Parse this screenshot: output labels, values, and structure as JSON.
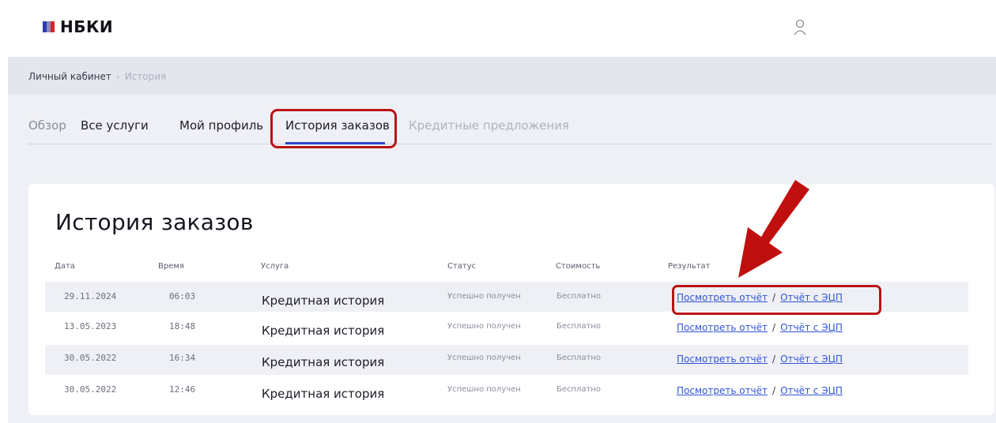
{
  "app": {
    "logo_text": "НБКИ"
  },
  "colors": {
    "accent_blue": "#2f45c8",
    "link_blue": "#2f54d8",
    "annotation_red": "#b81414",
    "logo_red": "#d1262e",
    "logo_blue": "#2b3fb2"
  },
  "icons": {
    "user": "user-icon",
    "arrow": "arrow-annotation-icon"
  },
  "breadcrumb": {
    "home": "Личный кабинет",
    "separator": "›",
    "current": "История"
  },
  "tabs": [
    {
      "label": "Обзор"
    },
    {
      "label": "Все услуги"
    },
    {
      "label": "Мой профиль"
    },
    {
      "label": "История заказов",
      "active": true
    },
    {
      "label": "Кредитные предложения"
    }
  ],
  "orders": {
    "title": "История заказов",
    "columns": [
      "Дата",
      "Время",
      "Услуга",
      "Статус",
      "Стоимость",
      "Результат"
    ],
    "rows": [
      {
        "date": "29.11.2024",
        "time": "06:03",
        "service": "Кредитная история",
        "status": "Успешно получен",
        "cost": "Бесплатно",
        "link_report": "Посмотреть отчёт",
        "link_ecp": "Отчёт с ЭЦП"
      },
      {
        "date": "13.05.2023",
        "time": "18:48",
        "service": "Кредитная история",
        "status": "Успешно получен",
        "cost": "Бесплатно",
        "link_report": "Посмотреть отчёт",
        "link_ecp": "Отчёт с ЭЦП"
      },
      {
        "date": "30.05.2022",
        "time": "16:34",
        "service": "Кредитная история",
        "status": "Успешно получен",
        "cost": "Бесплатно",
        "link_report": "Посмотреть отчёт",
        "link_ecp": "Отчёт с ЭЦП"
      },
      {
        "date": "30.05.2022",
        "time": "12:46",
        "service": "Кредитная история",
        "status": "Успешно получен",
        "cost": "Бесплатно",
        "link_report": "Посмотреть отчёт",
        "link_ecp": "Отчёт с ЭЦП"
      }
    ],
    "link_separator": "/"
  }
}
